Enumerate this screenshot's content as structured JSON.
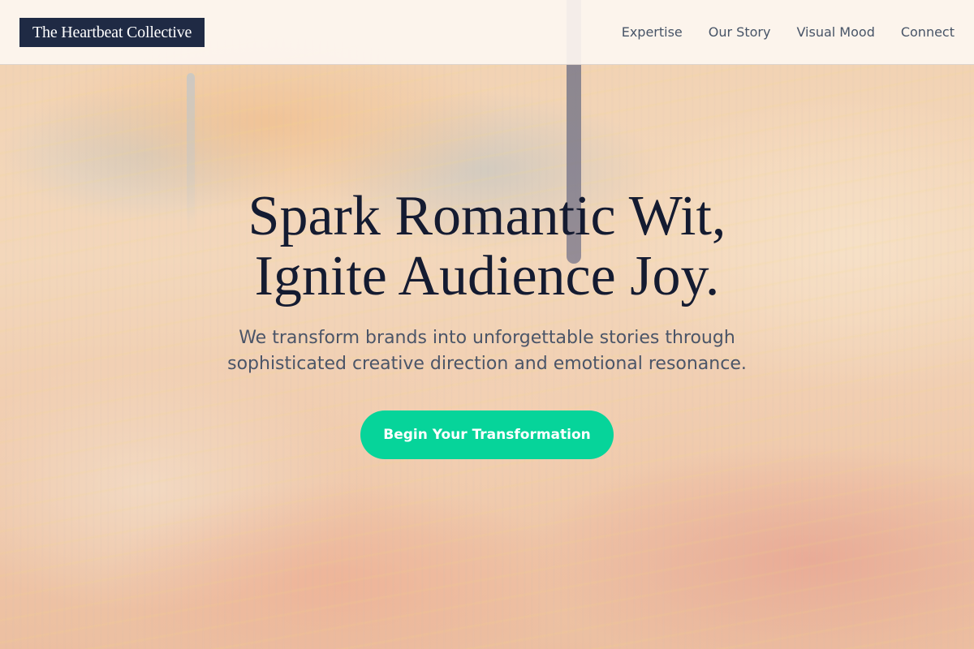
{
  "header": {
    "logo_text": "The Heartbeat Collective",
    "nav": [
      {
        "label": "Expertise"
      },
      {
        "label": "Our Story"
      },
      {
        "label": "Visual Mood"
      },
      {
        "label": "Connect"
      }
    ]
  },
  "hero": {
    "title_lines": [
      "Spark Romantic Wit,",
      "Ignite Audience Joy."
    ],
    "subtitle_lines": [
      "We transform brands into unforgettable stories through",
      "sophisticated creative direction and emotional resonance."
    ],
    "cta_label": "Begin Your Transformation"
  },
  "colors": {
    "logo_bg": "#1f2a44",
    "cta_bg": "#06d49a",
    "title_text": "#141b31",
    "nav_text": "#475467"
  }
}
